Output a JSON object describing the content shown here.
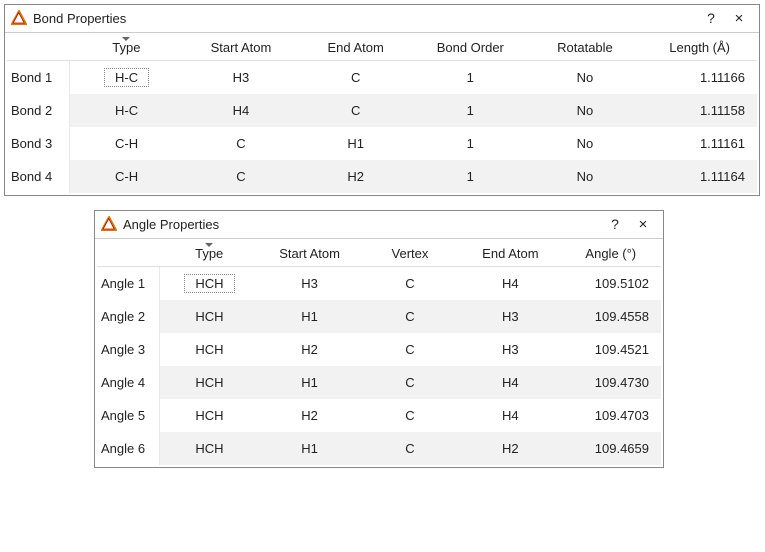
{
  "bond_dialog": {
    "title": "Bond Properties",
    "help_label": "?",
    "close_label": "×",
    "columns": [
      "Type",
      "Start Atom",
      "End Atom",
      "Bond Order",
      "Rotatable",
      "Length (Å)"
    ],
    "sorted_col": 0,
    "row_labels": [
      "Bond 1",
      "Bond 2",
      "Bond 3",
      "Bond 4"
    ],
    "rows": [
      {
        "type": "H-C",
        "start": "H3",
        "end": "C",
        "order": "1",
        "rot": "No",
        "len": "1.11166"
      },
      {
        "type": "H-C",
        "start": "H4",
        "end": "C",
        "order": "1",
        "rot": "No",
        "len": "1.11158"
      },
      {
        "type": "C-H",
        "start": "C",
        "end": "H1",
        "order": "1",
        "rot": "No",
        "len": "1.11161"
      },
      {
        "type": "C-H",
        "start": "C",
        "end": "H2",
        "order": "1",
        "rot": "No",
        "len": "1.11164"
      }
    ]
  },
  "angle_dialog": {
    "title": "Angle Properties",
    "help_label": "?",
    "close_label": "×",
    "columns": [
      "Type",
      "Start Atom",
      "Vertex",
      "End Atom",
      "Angle (°)"
    ],
    "sorted_col": 0,
    "row_labels": [
      "Angle 1",
      "Angle 2",
      "Angle 3",
      "Angle 4",
      "Angle 5",
      "Angle 6"
    ],
    "rows": [
      {
        "type": "HCH",
        "start": "H3",
        "vertex": "C",
        "end": "H4",
        "angle": "109.5102"
      },
      {
        "type": "HCH",
        "start": "H1",
        "vertex": "C",
        "end": "H3",
        "angle": "109.4558"
      },
      {
        "type": "HCH",
        "start": "H2",
        "vertex": "C",
        "end": "H3",
        "angle": "109.4521"
      },
      {
        "type": "HCH",
        "start": "H1",
        "vertex": "C",
        "end": "H4",
        "angle": "109.4730"
      },
      {
        "type": "HCH",
        "start": "H2",
        "vertex": "C",
        "end": "H4",
        "angle": "109.4703"
      },
      {
        "type": "HCH",
        "start": "H1",
        "vertex": "C",
        "end": "H2",
        "angle": "109.4659"
      }
    ]
  }
}
